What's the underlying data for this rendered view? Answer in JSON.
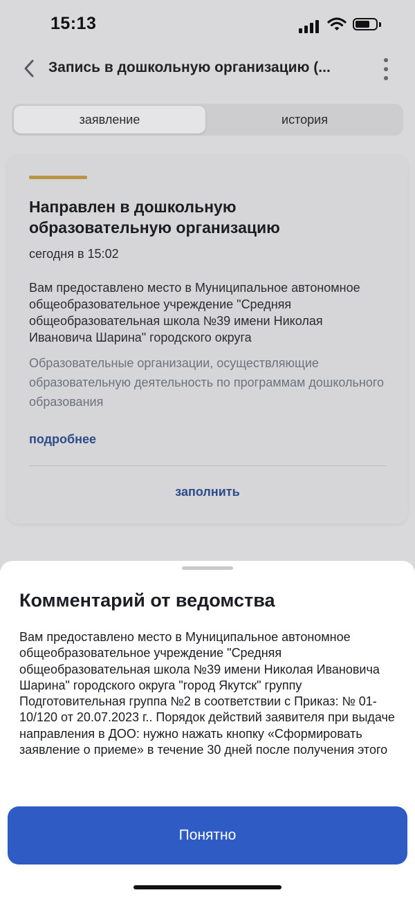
{
  "status_bar": {
    "time": "15:13"
  },
  "nav": {
    "title": "Запись в дошкольную организацию (..."
  },
  "tabs": [
    {
      "label": "заявление",
      "active": true
    },
    {
      "label": "история",
      "active": false
    }
  ],
  "card": {
    "status_title": "Направлен в дошкольную образовательную организацию",
    "date": "сегодня в 15:02",
    "description": "Вам предоставлено место в Муниципальное автономное общеобразовательное учреждение \"Средняя общеобразовательная школа №39 имени Николая Ивановича Шарина\" городского округа",
    "category": "Образовательные организации, осуществляющие образовательную деятельность по программам дошкольного образования",
    "more_link": "подробнее",
    "fill_button": "заполнить"
  },
  "sheet": {
    "title": "Комментарий от ведомства",
    "body": "Вам предоставлено место в Муниципальное автономное общеобразовательное учреждение \"Средняя общеобразовательная школа №39 имени Николая Ивановича Шарина\" городского округа \"город Якутск\" группу Подготовительная группа №2 в соответствии с Приказ: № 01-10/120 от 20.07.2023 г.. Порядок действий заявителя при выдаче направления в ДОО: нужно нажать кнопку «Сформировать заявление о приеме» в течение 30 дней после получения этого",
    "button": "Понятно"
  },
  "colors": {
    "accent": "#b89642",
    "link": "#2d4b8a",
    "primary_button": "#2f5bc4"
  }
}
